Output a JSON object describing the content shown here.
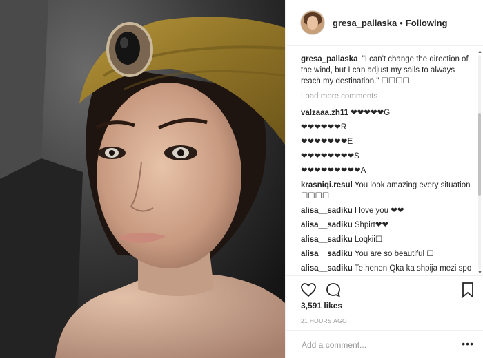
{
  "post": {
    "username": "gresa_pallaska",
    "separator": "•",
    "follow_status": "Following"
  },
  "caption": {
    "user": "gresa_pallaska",
    "text": "\"I can't change the direction of the wind, but I can adjust my sails to always reach my destination.\" ☐☐☐☐"
  },
  "load_more": "Load more comments",
  "comments": [
    {
      "user": "valzaaa.zh11",
      "text": "❤❤❤❤❤G"
    },
    {
      "user": "",
      "text": "❤❤❤❤❤❤R"
    },
    {
      "user": "",
      "text": "❤❤❤❤❤❤❤E"
    },
    {
      "user": "",
      "text": "❤❤❤❤❤❤❤❤S"
    },
    {
      "user": "",
      "text": "❤❤❤❤❤❤❤❤❤A"
    },
    {
      "user": "krasniqi.resul",
      "text": "You look amazing every situation ☐☐☐☐"
    },
    {
      "user": "alisa__sadiku",
      "text": "I love you ❤❤"
    },
    {
      "user": "alisa__sadiku",
      "text": "Shpirt❤❤"
    },
    {
      "user": "alisa__sadiku",
      "text": "Loqkii☐"
    },
    {
      "user": "alisa__sadiku",
      "text": "You are so beautiful ☐"
    },
    {
      "user": "alisa__sadiku",
      "text": "Te henen Qka ka shpija mezi spo pres met pa ty zemra jem☐☐"
    }
  ],
  "likes": "3,591 likes",
  "timestamp": "21 HOURS AGO",
  "add_comment_placeholder": "Add a comment...",
  "more_label": "•••",
  "icons": {
    "like": "heart-icon",
    "comment": "comment-bubble-icon",
    "save": "bookmark-icon"
  }
}
